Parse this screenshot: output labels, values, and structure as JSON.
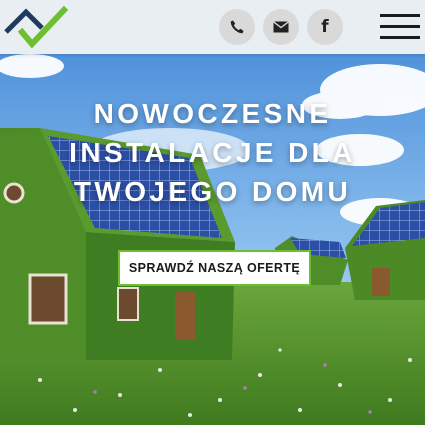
{
  "brand": {
    "logo_icon": "house-check-logo",
    "accent": "#6cbf2f",
    "dark": "#1f3a5f"
  },
  "header": {
    "contacts": [
      {
        "icon": "phone-icon",
        "name": "phone-button"
      },
      {
        "icon": "envelope-icon",
        "name": "email-button"
      },
      {
        "icon": "facebook-icon",
        "name": "facebook-button",
        "glyph": "f"
      }
    ],
    "menu_icon": "hamburger-menu-icon"
  },
  "hero": {
    "headline_lines": [
      "NOWOCZESNE",
      "INSTALACJE DLA",
      "TWOJEGO DOMU"
    ],
    "cta_label": "SPRAWDŹ NASZĄ OFERTĘ",
    "background": "grass-covered-houses-with-solar-panels"
  },
  "colors": {
    "sky": "#5d9fe0",
    "grass": "#4f8f2a",
    "panel": "#2b4fa8",
    "cta_border": "#6cbf2f"
  }
}
